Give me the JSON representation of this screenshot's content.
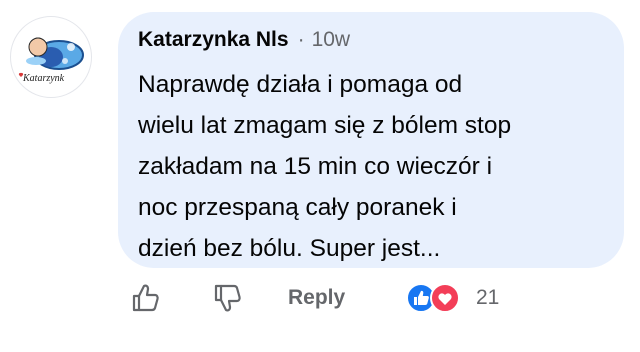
{
  "comment": {
    "author_name": "Katarzynka Nls",
    "separator": "·",
    "timestamp": "10w",
    "text": "Naprawdę działa i pomaga od\nwielu lat zmagam się z bólem stop\nzakładam na 15 min co wieczór i\nnoc przespaną cały poranek i\ndzień bez bólu. Super jest...",
    "avatar_caption": "Katarzynk"
  },
  "actions": {
    "like_icon": "thumbs-up-icon",
    "dislike_icon": "thumbs-down-icon",
    "reply_label": "Reply"
  },
  "reactions": {
    "types": [
      "like",
      "love"
    ],
    "count": "21",
    "like_color": "#1877f2",
    "love_color": "#f33e58"
  },
  "colors": {
    "bubble_bg": "#e8f0fd",
    "secondary_text": "#65676b"
  }
}
